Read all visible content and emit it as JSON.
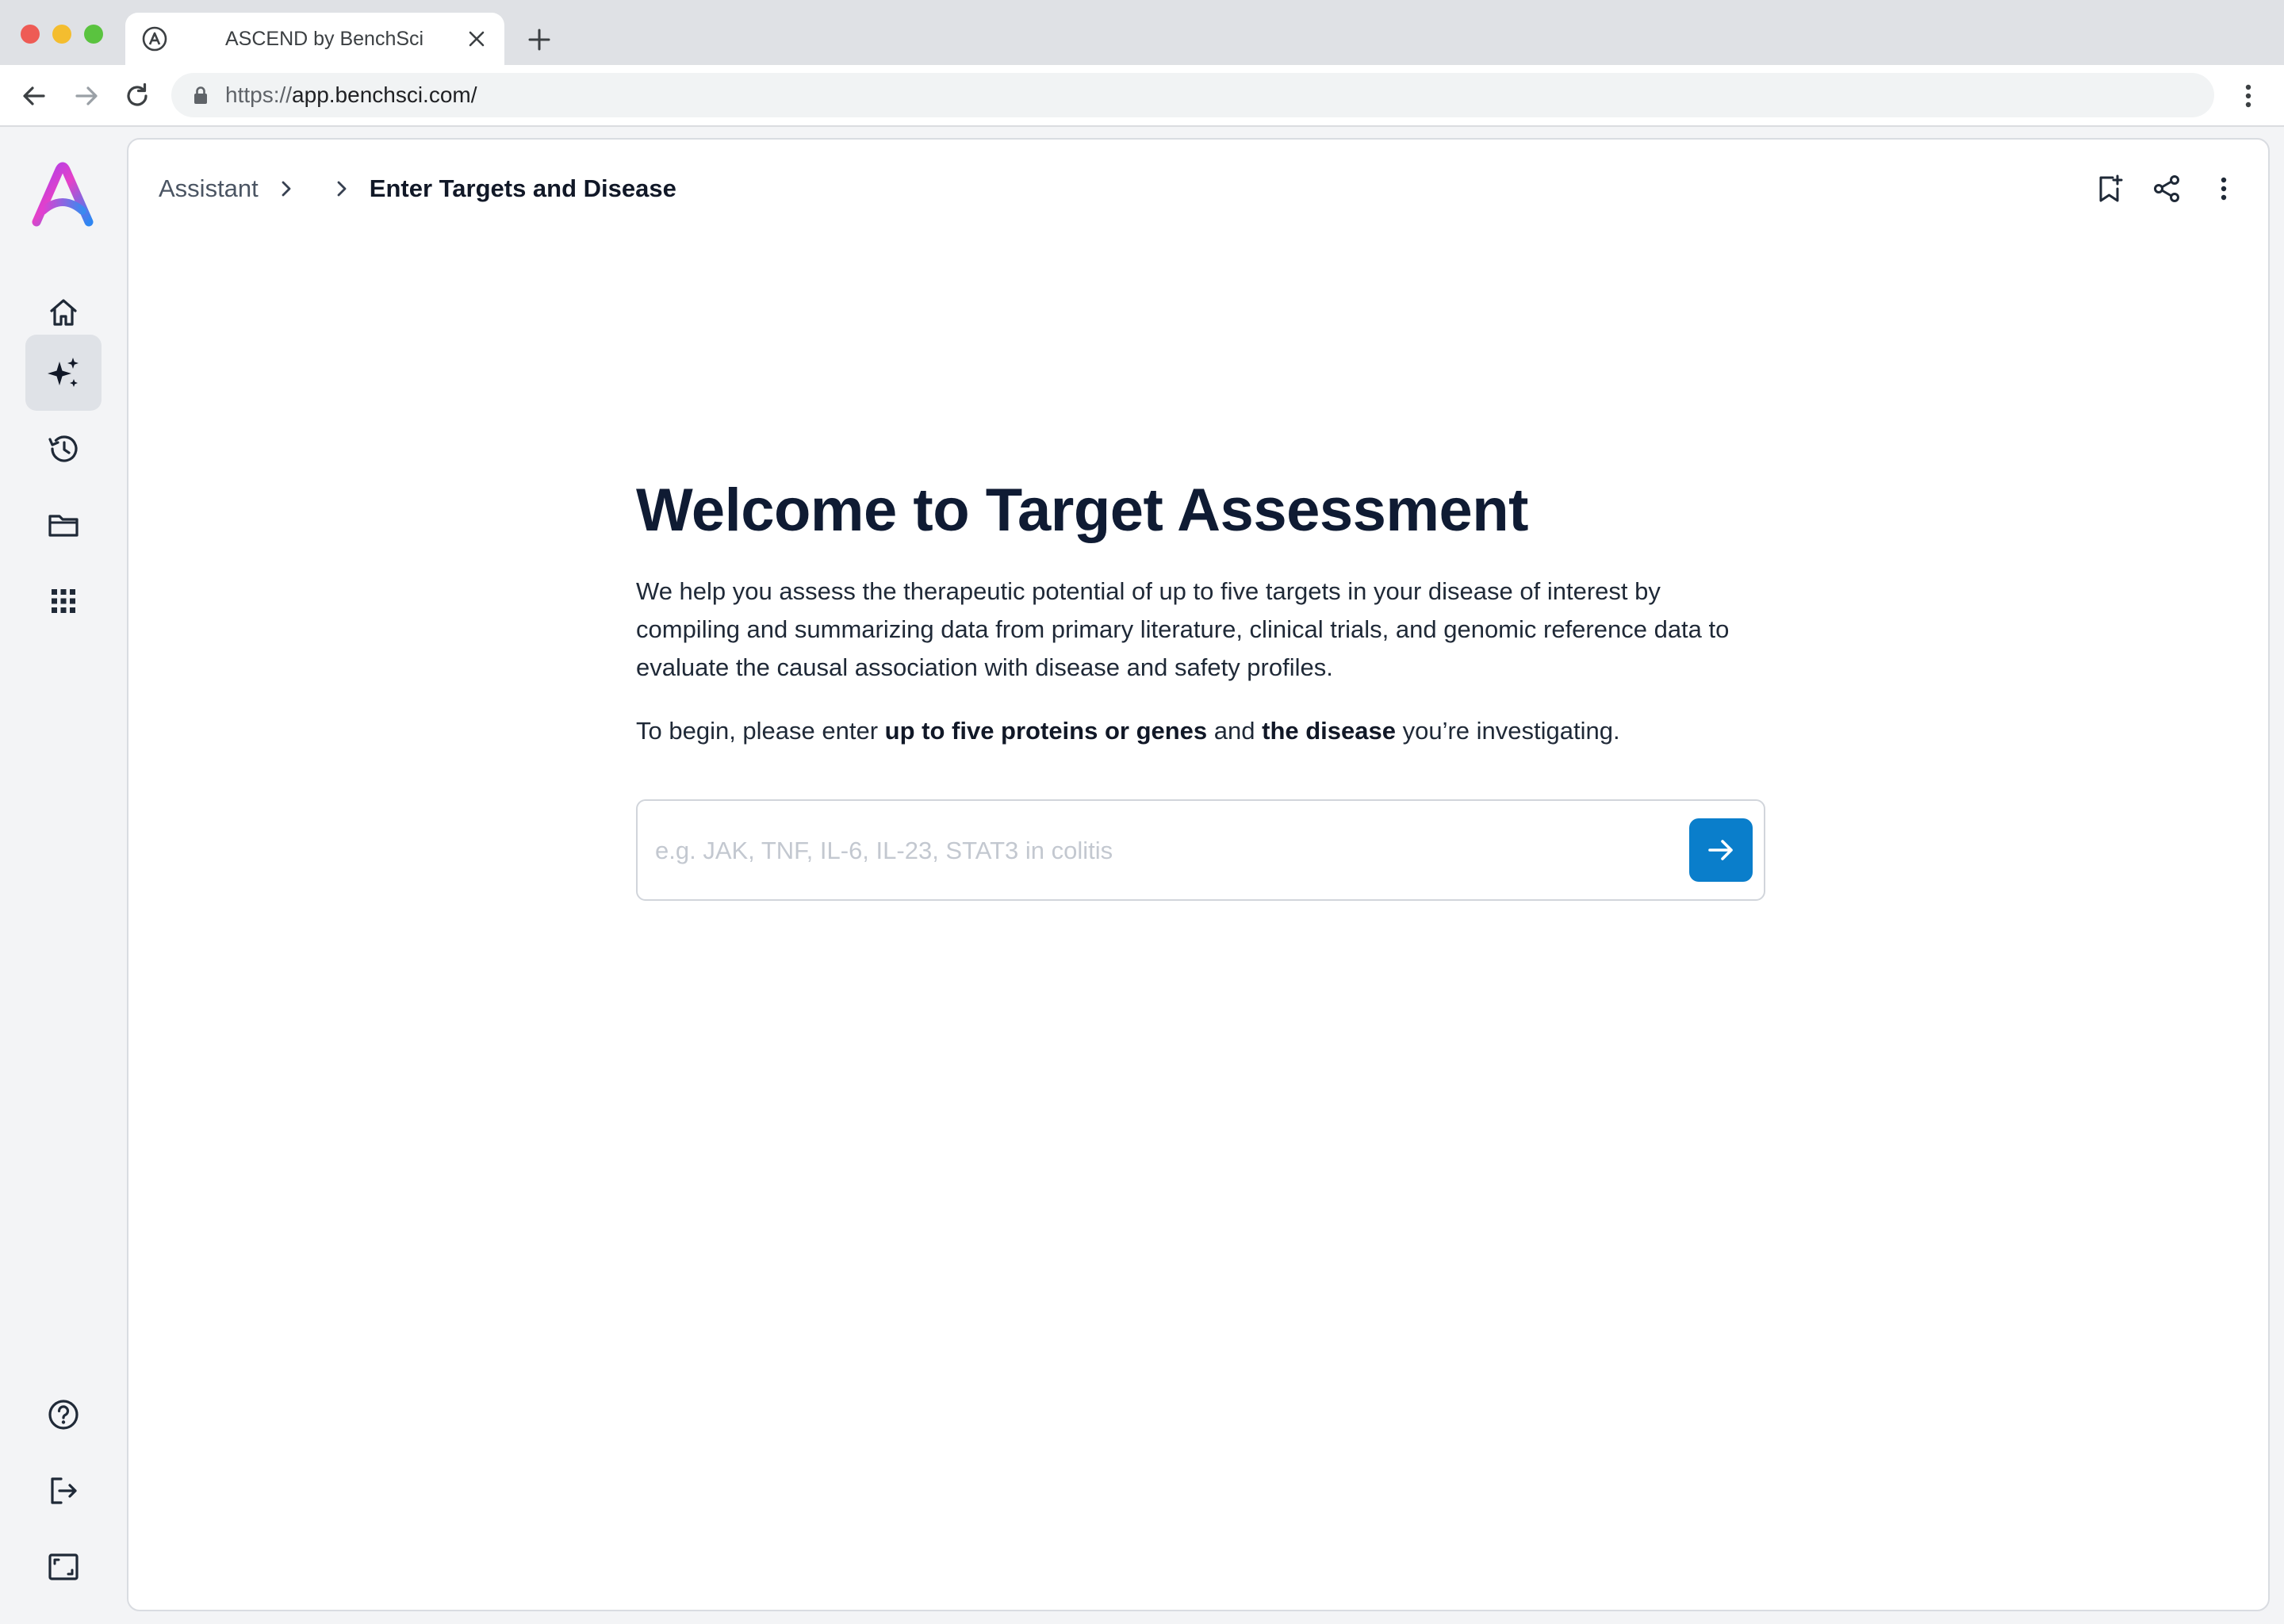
{
  "browser": {
    "tab_title": "ASCEND by BenchSci",
    "url_scheme": "https://",
    "url_host": "app.benchsci.com/"
  },
  "sidebar": {
    "items": [
      {
        "name": "home",
        "icon": "home-icon"
      },
      {
        "name": "assistant",
        "icon": "sparkles-icon",
        "active": true
      },
      {
        "name": "history",
        "icon": "history-icon"
      },
      {
        "name": "projects",
        "icon": "folder-icon"
      },
      {
        "name": "apps",
        "icon": "grid-icon"
      }
    ],
    "bottom_items": [
      {
        "name": "help",
        "icon": "help-icon"
      },
      {
        "name": "logout",
        "icon": "logout-icon"
      },
      {
        "name": "fullscreen",
        "icon": "fullscreen-icon"
      }
    ]
  },
  "breadcrumb": {
    "root": "Assistant",
    "current": "Enter Targets and Disease"
  },
  "main": {
    "title": "Welcome to Target Assessment",
    "description": "We help you assess the therapeutic potential of up to five targets in your disease of interest by compiling and summarizing data from primary literature, clinical trials, and genomic reference data to evaluate the causal association with disease and safety profiles.",
    "instruction_prefix": "To begin, please enter ",
    "instruction_bold1": "up to five proteins or genes",
    "instruction_mid": " and ",
    "instruction_bold2": "the disease",
    "instruction_suffix": " you’re investigating.",
    "input_placeholder": "e.g. JAK, TNF, IL-6, IL-23, STAT3 in colitis",
    "input_value": ""
  },
  "colors": {
    "accent": "#0a7ecb",
    "heading": "#0f1b33"
  }
}
